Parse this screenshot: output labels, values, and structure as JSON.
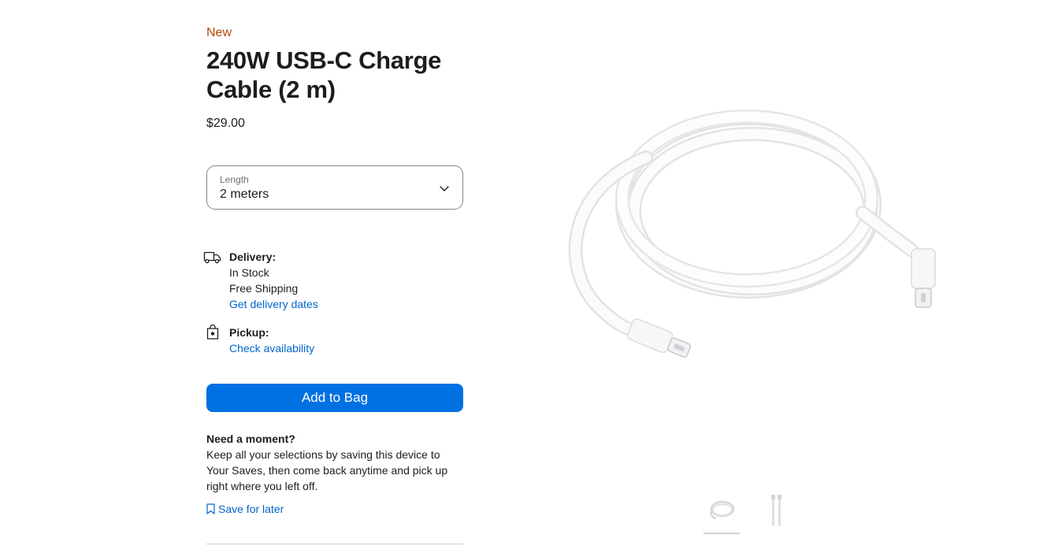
{
  "product": {
    "badge": "New",
    "title": "240W USB-C Charge Cable (2 m)",
    "price": "$29.00"
  },
  "length_select": {
    "label": "Length",
    "value": "2 meters"
  },
  "delivery": {
    "heading": "Delivery:",
    "stock": "In Stock",
    "shipping": "Free Shipping",
    "link": "Get delivery dates",
    "icon": "truck-icon"
  },
  "pickup": {
    "heading": "Pickup:",
    "link": "Check availability",
    "icon": "bag-icon"
  },
  "add_to_bag": {
    "label": "Add to Bag",
    "color": "#0071e3"
  },
  "save_section": {
    "heading": "Need a moment?",
    "body": "Keep all your selections by saving this device to Your Saves, then come back anytime and pick up right where you left off.",
    "link": "Save for later",
    "icon": "bookmark-icon"
  },
  "gallery": {
    "active_index": 0,
    "thumbnail_count": 2
  },
  "colors": {
    "badge": "#b64400",
    "link": "#0066cc",
    "text": "#1d1d1f"
  }
}
